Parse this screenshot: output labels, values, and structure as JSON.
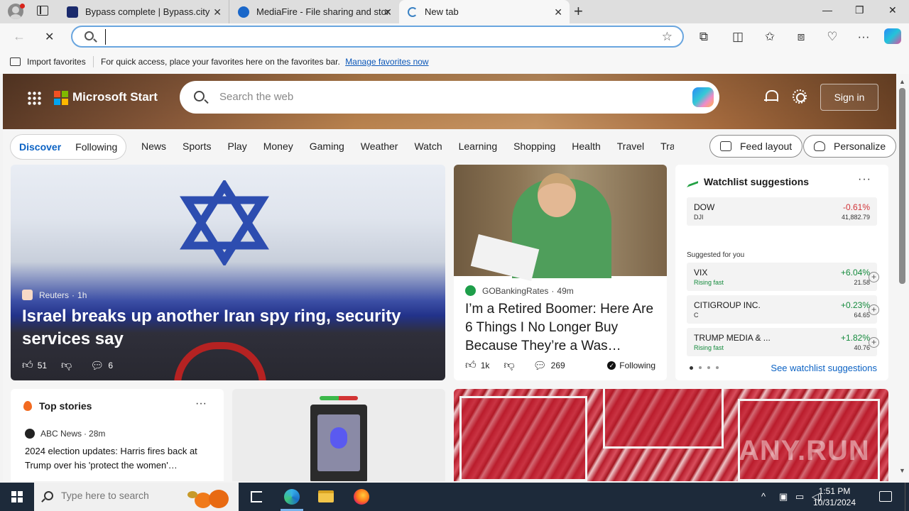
{
  "browser": {
    "tabs": [
      {
        "title": "Bypass complete | Bypass.city",
        "close": "✕"
      },
      {
        "title": "MediaFire - File sharing and storage",
        "close": "✕"
      },
      {
        "title": "New tab",
        "close": "✕"
      }
    ],
    "new_tab_glyph": "+",
    "window_controls": {
      "minimize": "—",
      "restore": "❐",
      "close": "✕"
    },
    "address": {
      "value": "",
      "placeholder": ""
    },
    "nav_glyphs": {
      "back": "←",
      "stop": "✕",
      "star": "☆"
    },
    "toolbar_glyphs": {
      "extensions": "⧉",
      "split": "◫",
      "favorites": "✩",
      "collections": "⧈",
      "performance": "♡",
      "more": "···"
    }
  },
  "favorites_bar": {
    "import_label": "Import favorites",
    "message": "For quick access, place your favorites here on the favorites bar.",
    "link": "Manage favorites now"
  },
  "header": {
    "brand": "Microsoft Start",
    "search_placeholder": "Search the web",
    "sign_in": "Sign in"
  },
  "nav": {
    "discover": "Discover",
    "following": "Following",
    "links": [
      "News",
      "Sports",
      "Play",
      "Money",
      "Gaming",
      "Weather",
      "Watch",
      "Learning",
      "Shopping",
      "Health",
      "Travel",
      "Traf"
    ],
    "feed_layout": "Feed layout",
    "personalize": "Personalize"
  },
  "cards": {
    "israel": {
      "source": "Reuters",
      "time": "1h",
      "headline": "Israel breaks up another Iran spy ring, security services say",
      "likes": "51",
      "comments": "6"
    },
    "boomer": {
      "source": "GOBankingRates",
      "time": "49m",
      "headline": "I’m a Retired Boomer: Here Are 6 Things I No Longer Buy Because They’re a Was…",
      "likes": "1k",
      "comments": "269",
      "following": "Following"
    },
    "watchlist": {
      "title": "Watchlist suggestions",
      "more": "···",
      "suggested_label": "Suggested for you",
      "see_more": "See watchlist suggestions",
      "stocks": [
        {
          "name": "DOW",
          "sub": "DJI",
          "change": "-0.61%",
          "price": "41,882.79",
          "trend": "down"
        },
        {
          "name": "VIX",
          "sub": "Rising fast",
          "change": "+6.04%",
          "price": "21.58",
          "trend": "up"
        },
        {
          "name": "CITIGROUP INC.",
          "sub": "C",
          "change": "+0.23%",
          "price": "64.65",
          "trend": "up"
        },
        {
          "name": "TRUMP MEDIA & ...",
          "sub": "Rising fast",
          "change": "+1.82%",
          "price": "40.76",
          "trend": "up"
        }
      ]
    },
    "top_stories": {
      "title": "Top stories",
      "more": "···",
      "source": "ABC News",
      "time": "28m",
      "headline": "2024 election updates: Harris fires back at Trump over his 'protect the women'…"
    }
  },
  "taskbar": {
    "search_placeholder": "Type here to search",
    "time": "1:51 PM",
    "date": "10/31/2024"
  },
  "watermark": "ANY.RUN",
  "colors": {
    "accent": "#0b62c4",
    "up": "#148a3c",
    "down": "#d13438"
  }
}
